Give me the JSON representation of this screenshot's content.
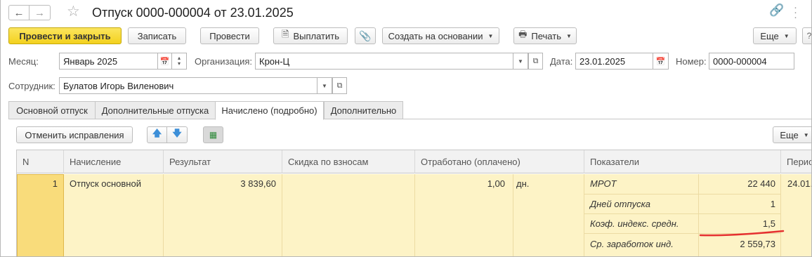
{
  "window": {
    "title": "Отпуск 0000-000004 от 23.01.2025"
  },
  "toolbar": {
    "post_close": "Провести и закрыть",
    "save": "Записать",
    "post": "Провести",
    "pay": "Выплатить",
    "create_based": "Создать на основании",
    "print": "Печать",
    "more": "Еще"
  },
  "form": {
    "month_label": "Месяц:",
    "month_value": "Январь 2025",
    "org_label": "Организация:",
    "org_value": "Крон-Ц",
    "date_label": "Дата:",
    "date_value": "23.01.2025",
    "number_label": "Номер:",
    "number_value": "0000-000004",
    "employee_label": "Сотрудник:",
    "employee_value": "Булатов Игорь Виленович"
  },
  "tabs": [
    {
      "label": "Основной отпуск",
      "active": false
    },
    {
      "label": "Дополнительные отпуска",
      "active": false
    },
    {
      "label": "Начислено (подробно)",
      "active": true
    },
    {
      "label": "Дополнительно",
      "active": false
    }
  ],
  "grid_toolbar": {
    "cancel_corrections": "Отменить исправления",
    "more": "Еще"
  },
  "table": {
    "columns": [
      "N",
      "Начисление",
      "Результат",
      "Скидка по взносам",
      "Отработано (оплачено)",
      "Показатели",
      "Перио"
    ],
    "row": {
      "n": "1",
      "accrual": "Отпуск основной",
      "result": "3 839,60",
      "discount": "",
      "worked_value": "1,00",
      "worked_unit": "дн.",
      "period": "24.01."
    },
    "indicators": [
      {
        "name": "МРОТ",
        "value": "22 440"
      },
      {
        "name": "Дней отпуска",
        "value": "1"
      },
      {
        "name": "Коэф. индекс. средн.",
        "value": "1,5"
      },
      {
        "name": "Ср. заработок инд.",
        "value": "2 559,73"
      }
    ]
  },
  "colors": {
    "primary_button": "#f3d11e",
    "row_highlight": "#fdf3c6",
    "current_cell": "#f9dc7b",
    "annotation_underline": "#e53030",
    "arrow_icon": "#3d8fd8"
  }
}
